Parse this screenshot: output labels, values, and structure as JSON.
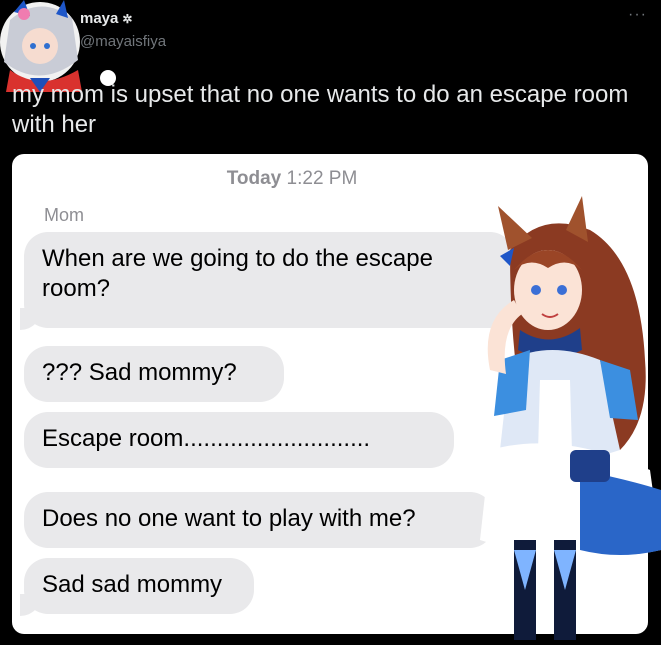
{
  "tweet": {
    "display_name": "maya",
    "handle": "@mayaisfiya",
    "more_label": "···",
    "text": "my mom is upset that no one wants to do an escape room with her"
  },
  "screenshot": {
    "timestamp_day": "Today",
    "timestamp_time": "1:22 PM",
    "sender": "Mom",
    "messages": [
      "When are we going to do the escape room?",
      "??? Sad mommy?",
      "Escape room............................",
      "Does no one want to play with me?",
      "Sad sad mommy"
    ]
  },
  "colors": {
    "background": "#000000",
    "bubble": "#e9e9eb",
    "secondary_text": "#71767b"
  }
}
